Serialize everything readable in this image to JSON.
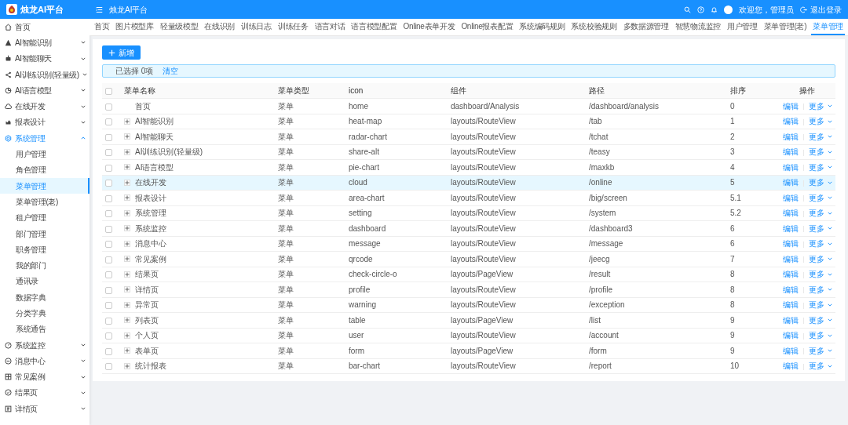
{
  "sidebar": {
    "logo_text": "烛龙AI平台",
    "items": [
      {
        "label": "首页",
        "expanded": false,
        "has_children": false
      },
      {
        "label": "AI智能识别",
        "expanded": false,
        "has_children": true
      },
      {
        "label": "AI智能聊天",
        "expanded": false,
        "has_children": true
      },
      {
        "label": "AI训练识别(轻量级)",
        "expanded": false,
        "has_children": true
      },
      {
        "label": "AI语言模型",
        "expanded": false,
        "has_children": true
      },
      {
        "label": "在线开发",
        "expanded": false,
        "has_children": true
      },
      {
        "label": "报表设计",
        "expanded": false,
        "has_children": true
      },
      {
        "label": "系统管理",
        "expanded": true,
        "has_children": true,
        "children": [
          {
            "label": "用户管理",
            "selected": false
          },
          {
            "label": "角色管理",
            "selected": false
          },
          {
            "label": "菜单管理",
            "selected": true
          },
          {
            "label": "菜单管理(老)",
            "selected": false
          },
          {
            "label": "租户管理",
            "selected": false
          },
          {
            "label": "部门管理",
            "selected": false
          },
          {
            "label": "职务管理",
            "selected": false
          },
          {
            "label": "我的部门",
            "selected": false
          },
          {
            "label": "通讯录",
            "selected": false
          },
          {
            "label": "数据字典",
            "selected": false
          },
          {
            "label": "分类字典",
            "selected": false
          },
          {
            "label": "系统通告",
            "selected": false
          }
        ]
      },
      {
        "label": "系统监控",
        "expanded": false,
        "has_children": true
      },
      {
        "label": "消息中心",
        "expanded": false,
        "has_children": true
      },
      {
        "label": "常见案例",
        "expanded": false,
        "has_children": true
      },
      {
        "label": "结果页",
        "expanded": false,
        "has_children": true
      },
      {
        "label": "详情页",
        "expanded": false,
        "has_children": true
      }
    ]
  },
  "header": {
    "title": "烛龙AI平台",
    "greeting": "欢迎您，管理员",
    "logout": "退出登录"
  },
  "tabs": [
    {
      "label": "首页",
      "selected": false
    },
    {
      "label": "图片模型库",
      "selected": false
    },
    {
      "label": "轻量级模型",
      "selected": false
    },
    {
      "label": "在线识别",
      "selected": false
    },
    {
      "label": "训练日志",
      "selected": false
    },
    {
      "label": "训练任务",
      "selected": false
    },
    {
      "label": "语言对话",
      "selected": false
    },
    {
      "label": "语言模型配置",
      "selected": false
    },
    {
      "label": "Online表单开发",
      "selected": false
    },
    {
      "label": "Online报表配置",
      "selected": false
    },
    {
      "label": "系统编码规则",
      "selected": false
    },
    {
      "label": "系统校验规则",
      "selected": false
    },
    {
      "label": "多数据源管理",
      "selected": false
    },
    {
      "label": "智慧物流监控",
      "selected": false
    },
    {
      "label": "用户管理",
      "selected": false
    },
    {
      "label": "菜单管理(老)",
      "selected": false
    },
    {
      "label": "菜单管理",
      "selected": true
    }
  ],
  "add_button": "新增",
  "selection": {
    "text": "已选择 0项",
    "clear": "清空"
  },
  "table": {
    "select_all_checked": false,
    "columns": [
      "菜单名称",
      "菜单类型",
      "icon",
      "组件",
      "路径",
      "排序",
      "操作"
    ],
    "rows": [
      {
        "cells": [
          "首页",
          "菜单",
          "home",
          "dashboard/Analysis",
          "/dashboard/analysis",
          "0"
        ],
        "edit": "编辑",
        "more": "更多",
        "expandable": false,
        "checked": false,
        "highlighted": false
      },
      {
        "cells": [
          "AI智能识别",
          "菜单",
          "heat-map",
          "layouts/RouteView",
          "/tab",
          "1"
        ],
        "edit": "编辑",
        "more": "更多",
        "expandable": true,
        "checked": false,
        "highlighted": false
      },
      {
        "cells": [
          "AI智能聊天",
          "菜单",
          "radar-chart",
          "layouts/RouteView",
          "/tchat",
          "2"
        ],
        "edit": "编辑",
        "more": "更多",
        "expandable": true,
        "checked": false,
        "highlighted": false
      },
      {
        "cells": [
          "AI训练识别(轻量级)",
          "菜单",
          "share-alt",
          "layouts/RouteView",
          "/teasy",
          "3"
        ],
        "edit": "编辑",
        "more": "更多",
        "expandable": true,
        "checked": false,
        "highlighted": false
      },
      {
        "cells": [
          "AI语言模型",
          "菜单",
          "pie-chart",
          "layouts/RouteView",
          "/maxkb",
          "4"
        ],
        "edit": "编辑",
        "more": "更多",
        "expandable": true,
        "checked": false,
        "highlighted": false
      },
      {
        "cells": [
          "在线开发",
          "菜单",
          "cloud",
          "layouts/RouteView",
          "/online",
          "5"
        ],
        "edit": "编辑",
        "more": "更多",
        "expandable": true,
        "checked": false,
        "highlighted": true
      },
      {
        "cells": [
          "报表设计",
          "菜单",
          "area-chart",
          "layouts/RouteView",
          "/big/screen",
          "5.1"
        ],
        "edit": "编辑",
        "more": "更多",
        "expandable": true,
        "checked": false,
        "highlighted": false
      },
      {
        "cells": [
          "系统管理",
          "菜单",
          "setting",
          "layouts/RouteView",
          "/system",
          "5.2"
        ],
        "edit": "编辑",
        "more": "更多",
        "expandable": true,
        "checked": false,
        "highlighted": false
      },
      {
        "cells": [
          "系统监控",
          "菜单",
          "dashboard",
          "layouts/RouteView",
          "/dashboard3",
          "6"
        ],
        "edit": "编辑",
        "more": "更多",
        "expandable": true,
        "checked": false,
        "highlighted": false
      },
      {
        "cells": [
          "消息中心",
          "菜单",
          "message",
          "layouts/RouteView",
          "/message",
          "6"
        ],
        "edit": "编辑",
        "more": "更多",
        "expandable": true,
        "checked": false,
        "highlighted": false
      },
      {
        "cells": [
          "常见案例",
          "菜单",
          "qrcode",
          "layouts/RouteView",
          "/jeecg",
          "7"
        ],
        "edit": "编辑",
        "more": "更多",
        "expandable": true,
        "checked": false,
        "highlighted": false
      },
      {
        "cells": [
          "结果页",
          "菜单",
          "check-circle-o",
          "layouts/PageView",
          "/result",
          "8"
        ],
        "edit": "编辑",
        "more": "更多",
        "expandable": true,
        "checked": false,
        "highlighted": false
      },
      {
        "cells": [
          "详情页",
          "菜单",
          "profile",
          "layouts/RouteView",
          "/profile",
          "8"
        ],
        "edit": "编辑",
        "more": "更多",
        "expandable": true,
        "checked": false,
        "highlighted": false
      },
      {
        "cells": [
          "异常页",
          "菜单",
          "warning",
          "layouts/RouteView",
          "/exception",
          "8"
        ],
        "edit": "编辑",
        "more": "更多",
        "expandable": true,
        "checked": false,
        "highlighted": false
      },
      {
        "cells": [
          "列表页",
          "菜单",
          "table",
          "layouts/PageView",
          "/list",
          "9"
        ],
        "edit": "编辑",
        "more": "更多",
        "expandable": true,
        "checked": false,
        "highlighted": false
      },
      {
        "cells": [
          "个人页",
          "菜单",
          "user",
          "layouts/RouteView",
          "/account",
          "9"
        ],
        "edit": "编辑",
        "more": "更多",
        "expandable": true,
        "checked": false,
        "highlighted": false
      },
      {
        "cells": [
          "表单页",
          "菜单",
          "form",
          "layouts/PageView",
          "/form",
          "9"
        ],
        "edit": "编辑",
        "more": "更多",
        "expandable": true,
        "checked": false,
        "highlighted": false
      },
      {
        "cells": [
          "统计报表",
          "菜单",
          "bar-chart",
          "layouts/RouteView",
          "/report",
          "10"
        ],
        "edit": "编辑",
        "more": "更多",
        "expandable": true,
        "checked": false,
        "highlighted": false
      }
    ]
  }
}
